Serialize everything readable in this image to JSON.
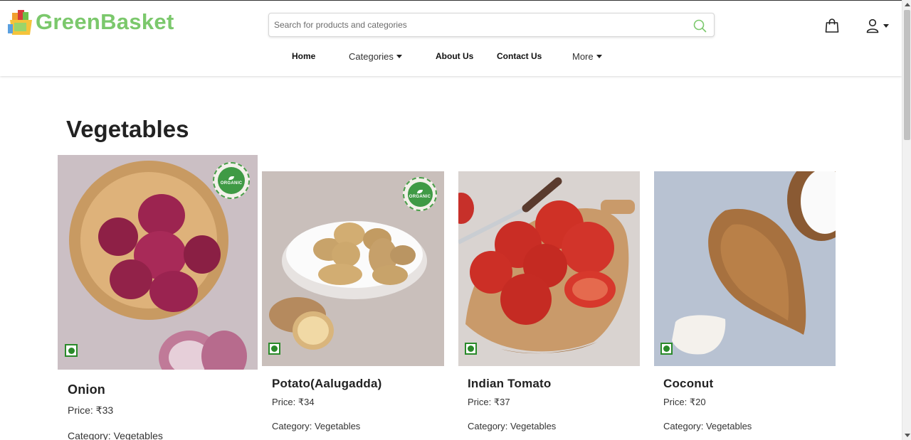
{
  "brand": {
    "name": "GreenBasket"
  },
  "search": {
    "placeholder": "Search for products and categories"
  },
  "nav": {
    "items": [
      {
        "label": "Home"
      },
      {
        "label": "Categories"
      },
      {
        "label": "About Us"
      },
      {
        "label": "Contact Us"
      },
      {
        "label": "More"
      }
    ]
  },
  "page": {
    "title": "Vegetables"
  },
  "products": [
    {
      "name": "Onion",
      "price": "Price: ₹33",
      "category": "Category: Vegetables",
      "organic": true,
      "badge_text": "ORGANIC"
    },
    {
      "name": "Potato(Aalugadda)",
      "price": "Price: ₹34",
      "category": "Category: Vegetables",
      "organic": true,
      "badge_text": "ORGANIC"
    },
    {
      "name": "Indian Tomato",
      "price": "Price: ₹37",
      "category": "Category: Vegetables",
      "organic": false
    },
    {
      "name": "Coconut",
      "price": "Price: ₹20",
      "category": "Category: Vegetables",
      "organic": false
    }
  ],
  "colors": {
    "brand": "#7bc86c",
    "veg_mark": "#2a8a2a",
    "organic_badge": "#3f9a45"
  },
  "icons": {
    "search": "search-icon",
    "cart": "shopping-bag-icon",
    "account": "user-icon",
    "veg": "veg-mark-icon"
  }
}
